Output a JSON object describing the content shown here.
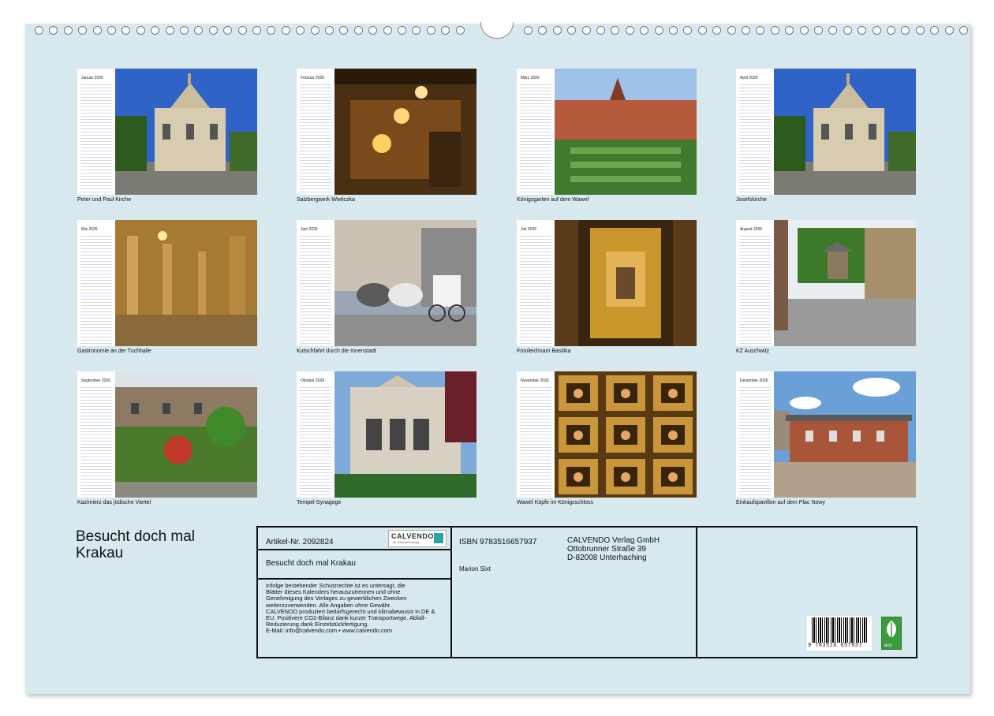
{
  "colors": {
    "sheet": "#d7e8ee",
    "accent": "#2aa6a0",
    "eco_green": "#3c9b3a"
  },
  "months": [
    {
      "name": "Januar 2026",
      "caption": "Peter und Paul Kirche",
      "icon": "church-photo"
    },
    {
      "name": "Februar 2026",
      "caption": "Salzbergwerk Wieliczka",
      "icon": "salt-mine-photo"
    },
    {
      "name": "März 2026",
      "caption": "Königsgarten auf dem Wawel",
      "icon": "garden-photo"
    },
    {
      "name": "April 2026",
      "caption": "Josefskirche",
      "icon": "church-photo"
    },
    {
      "name": "Mai 2026",
      "caption": "Gastronomie an der Tuchhalle",
      "icon": "arcade-photo"
    },
    {
      "name": "Juni 2026",
      "caption": "Kutschfahrt durch die Innenstadt",
      "icon": "carriage-photo"
    },
    {
      "name": "Juli 2026",
      "caption": "Fronleichnam Basilika",
      "icon": "altar-photo"
    },
    {
      "name": "August 2026",
      "caption": "KZ Auschwitz",
      "icon": "fence-photo"
    },
    {
      "name": "September 2026",
      "caption": "Kazimierz das jüdische Viertel",
      "icon": "street-photo"
    },
    {
      "name": "Oktober 2026",
      "caption": "Tempel-Synagoge",
      "icon": "synagogue-photo"
    },
    {
      "name": "November 2026",
      "caption": "Wawel Köpfe im Königsschloss",
      "icon": "ceiling-heads-photo"
    },
    {
      "name": "Dezember 2026",
      "caption": "Einkaufspavillon auf dem Plac Nowy",
      "icon": "pavilion-photo"
    }
  ],
  "title_line1": "Besucht doch mal",
  "title_line2": "Krakau",
  "info": {
    "article": "Artikel-Nr. 2092824",
    "logo_text": "CALVENDO",
    "logo_sub": "Ihr Kalenderverlag",
    "product_title": "Besucht doch mal Krakau",
    "legal": [
      "Infolge bestehender Schutzrechte ist es untersagt, die",
      "Blätter dieses Kalenders herauszutrennen und ohne",
      "Genehmigung des Verlages zu gewerblichen Zwecken",
      "weiterzuverwenden. Alle Angaben ohne Gewähr.",
      "CALVENDO produziert bedarfsgerecht und klimabewusst in DE &",
      "EU. Positivere CO2-Bilanz dank kurzer Transportwege. Abfall-",
      "Reduzierung dank Einzelstückfertigung.",
      "E-Mail: info@calvendo.com • www.calvendo.com"
    ],
    "isbn": "ISBN 9783516657937",
    "author": "Marion Sixt",
    "publisher": [
      "CALVENDO Verlag GmbH",
      "Ottobrunner Straße 39",
      "D-82008 Unterhaching"
    ],
    "barcode_number": "9 783516 657937",
    "eco_label": "eco"
  }
}
